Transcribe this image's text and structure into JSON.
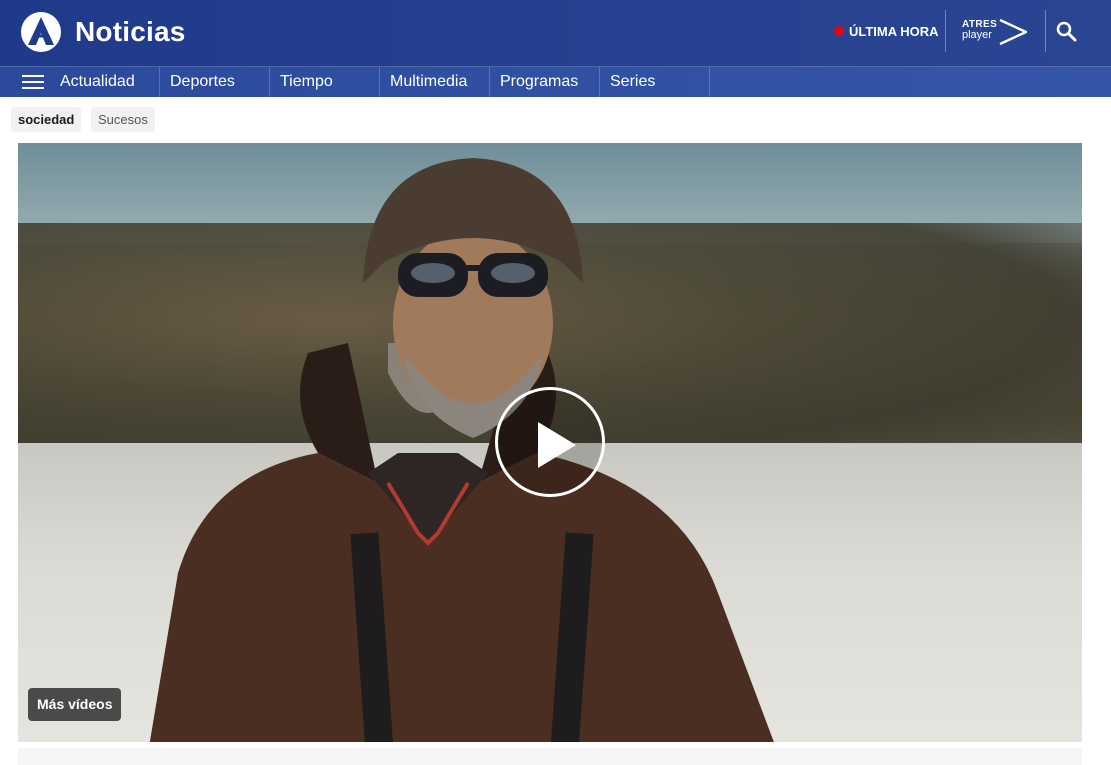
{
  "header": {
    "brand": "Noticias",
    "breaking_label": "ÚLTIMA HORA",
    "atres_top": "ATRES",
    "atres_bottom": "player"
  },
  "nav": {
    "items": [
      "Actualidad",
      "Deportes",
      "Tiempo",
      "Multimedia",
      "Programas",
      "Series"
    ]
  },
  "tags": [
    "sociedad",
    "Sucesos"
  ],
  "video": {
    "more_videos_label": "Más vídeos"
  },
  "colors": {
    "header_bg": "#1f3a8a",
    "nav_bg": "#2b4a9c",
    "breaking_dot": "#e30613"
  },
  "icons": [
    "antena3-logo-icon",
    "atresplayer-icon",
    "search-icon",
    "hamburger-menu-icon",
    "play-icon"
  ]
}
